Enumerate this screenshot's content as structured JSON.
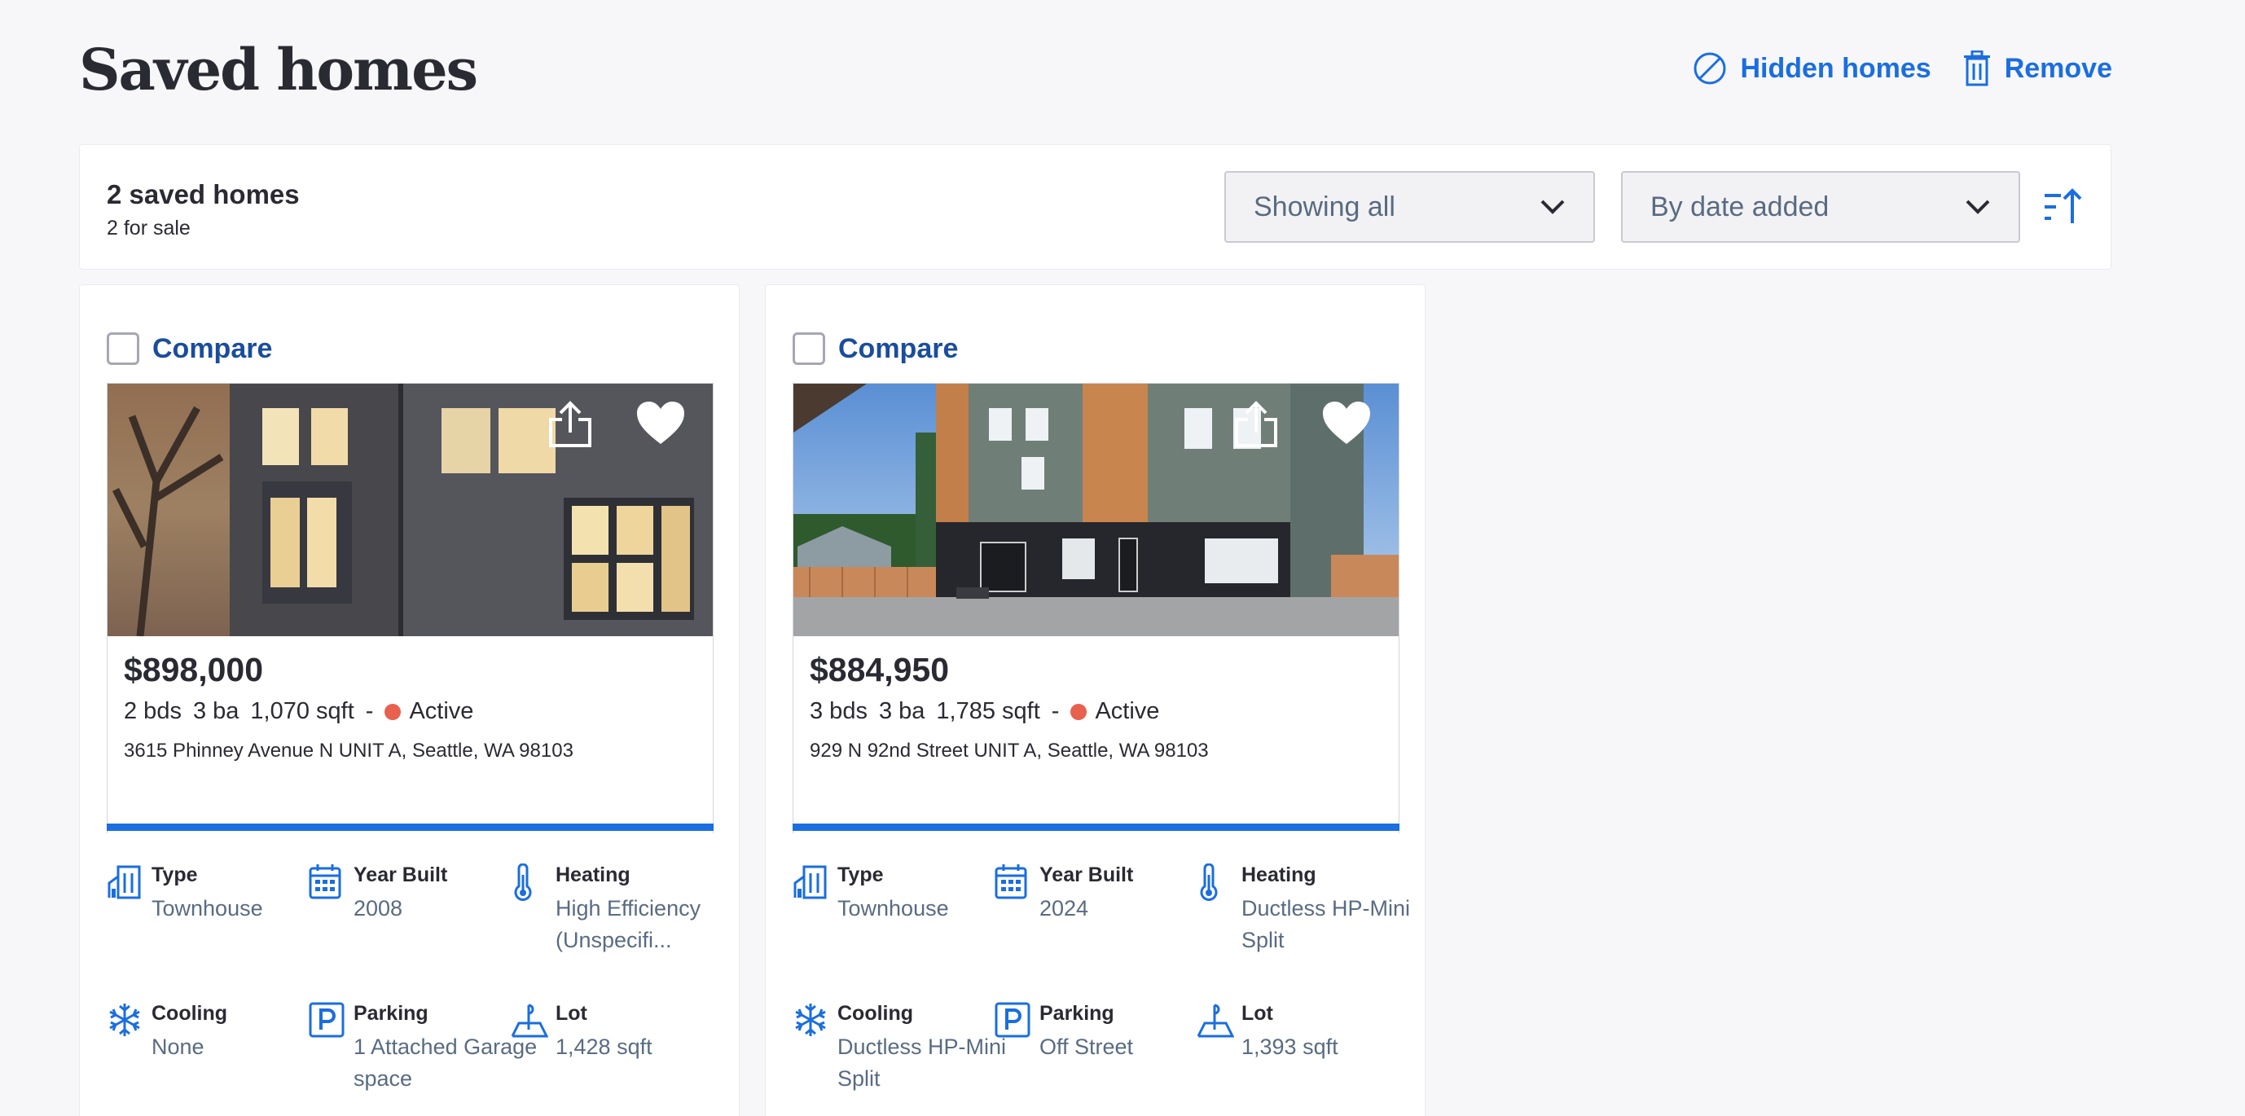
{
  "page": {
    "title": "Saved homes"
  },
  "header_actions": {
    "hidden_label": "Hidden homes",
    "remove_label": "Remove"
  },
  "toolbar": {
    "saved_count": "2 saved homes",
    "for_sale": "2 for sale",
    "filter_value": "Showing all",
    "sort_value": "By date added"
  },
  "colors": {
    "accent": "#1a6ee0",
    "compare": "#1a4d9e",
    "status_active": "#e8604e"
  },
  "icons": [
    "hidden-icon",
    "trash-icon",
    "chevron-down-icon",
    "sort-ascending-icon",
    "share-icon",
    "heart-icon",
    "building-icon",
    "calendar-icon",
    "thermometer-icon",
    "snowflake-icon",
    "parking-icon",
    "lot-icon"
  ],
  "cards": [
    {
      "compare_label": "Compare",
      "price": "$898,000",
      "beds": "2 bds",
      "baths": "3 ba",
      "sqft": "1,070 sqft",
      "sep": "-",
      "status": "Active",
      "address": "3615 Phinney Avenue N UNIT A, Seattle, WA 98103",
      "attrs": [
        {
          "label": "Type",
          "value": "Townhouse"
        },
        {
          "label": "Year Built",
          "value": "2008"
        },
        {
          "label": "Heating",
          "value": "High Efficiency (Unspecifi..."
        },
        {
          "label": "Cooling",
          "value": "None"
        },
        {
          "label": "Parking",
          "value": "1 Attached Garage space"
        },
        {
          "label": "Lot",
          "value": "1,428 sqft"
        }
      ]
    },
    {
      "compare_label": "Compare",
      "price": "$884,950",
      "beds": "3 bds",
      "baths": "3 ba",
      "sqft": "1,785 sqft",
      "sep": "-",
      "status": "Active",
      "address": "929 N 92nd Street UNIT A, Seattle, WA 98103",
      "attrs": [
        {
          "label": "Type",
          "value": "Townhouse"
        },
        {
          "label": "Year Built",
          "value": "2024"
        },
        {
          "label": "Heating",
          "value": "Ductless HP-Mini Split"
        },
        {
          "label": "Cooling",
          "value": "Ductless HP-Mini Split"
        },
        {
          "label": "Parking",
          "value": "Off Street"
        },
        {
          "label": "Lot",
          "value": "1,393 sqft"
        }
      ]
    }
  ]
}
